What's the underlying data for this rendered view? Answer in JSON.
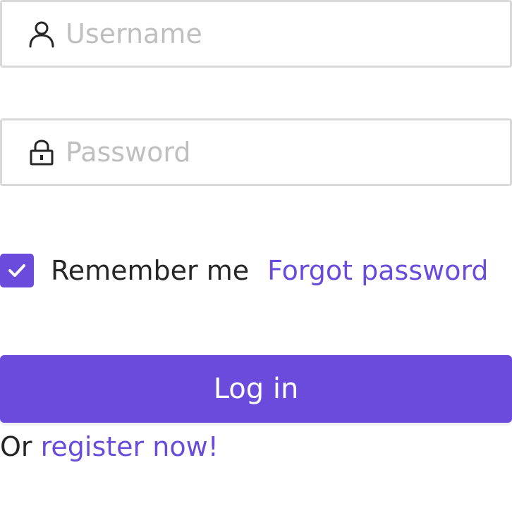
{
  "form": {
    "username": {
      "placeholder": "Username",
      "value": ""
    },
    "password": {
      "placeholder": "Password",
      "value": ""
    },
    "remember": {
      "label": "Remember me",
      "checked": true
    },
    "forgot_link": "Forgot password",
    "login_button": "Log in",
    "register": {
      "prefix": "Or",
      "link": "register now!"
    }
  },
  "icons": {
    "username": "user-icon",
    "password": "lock-icon",
    "checkbox": "checkmark-icon"
  },
  "colors": {
    "accent": "#6a4bdc",
    "border": "#d9d9d9",
    "placeholder": "#bfbfbf",
    "text": "#262626"
  }
}
